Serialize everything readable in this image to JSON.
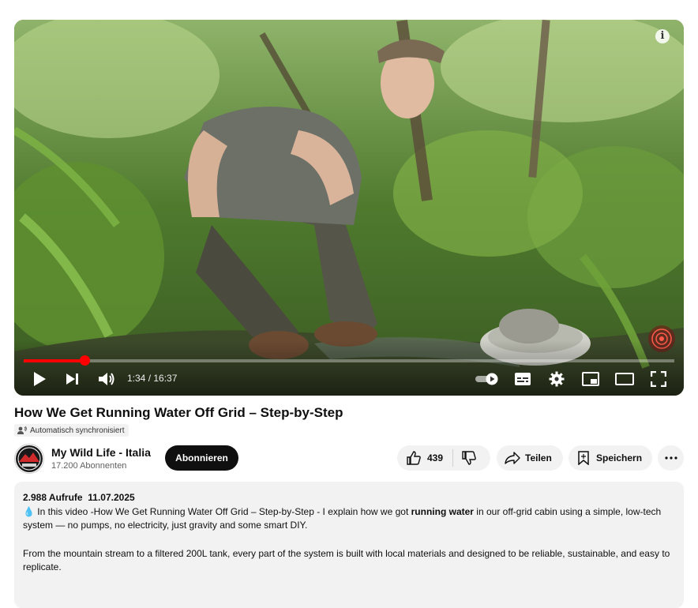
{
  "player": {
    "time_current": "1:34",
    "time_separator": " / ",
    "time_total": "16:37",
    "progress_fraction": 0.094,
    "accent_color": "#ff0000"
  },
  "video": {
    "title": "How We Get Running Water Off Grid – Step-by-Step",
    "caption_badge": "Automatisch synchronisiert"
  },
  "channel": {
    "name": "My Wild Life - Italia",
    "subscribers": "17.200 Abonnenten",
    "subscribe_label": "Abonnieren"
  },
  "actions": {
    "likes": "439",
    "share_label": "Teilen",
    "save_label": "Speichern"
  },
  "description": {
    "views": "2.988 Aufrufe",
    "date": "11.07.2025",
    "emoji": "💧",
    "text_before": " In this video -How We Get Running Water Off Grid – Step-by-Step - I explain how we got ",
    "text_bold": "running water",
    "text_after": " in our off-grid cabin using a simple, low-tech system — no pumps, no electricity, just gravity and some smart DIY.",
    "paragraph2": "From the mountain stream to a filtered 200L tank, every part of the system is built with local materials and designed to be reliable, sustainable, and easy to replicate."
  },
  "icons": {
    "play": "play-icon",
    "next": "next-icon",
    "volume": "volume-icon",
    "autoplay": "autoplay-toggle-icon",
    "subtitles": "subtitles-icon",
    "settings": "gear-icon",
    "miniplayer": "miniplayer-icon",
    "theater": "theater-mode-icon",
    "fullscreen": "fullscreen-icon",
    "like": "thumbs-up-icon",
    "dislike": "thumbs-down-icon",
    "share": "share-arrow-icon",
    "save": "bookmark-icon",
    "more": "more-horizontal-icon"
  }
}
